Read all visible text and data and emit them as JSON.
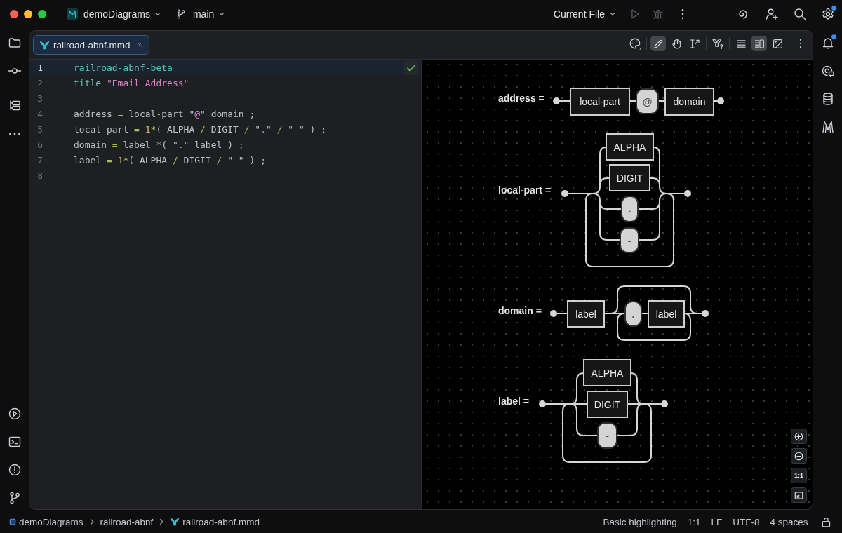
{
  "title_bar": {
    "project": "demoDiagrams",
    "branch": "main",
    "run_config": "Current File",
    "actions": [
      {
        "kind": "run",
        "disabled": true
      },
      {
        "kind": "debug",
        "disabled": true
      }
    ],
    "settings_badge": true
  },
  "right_toolbar": {
    "notifications_badge": true
  },
  "editor_tabs": [
    {
      "label": "railroad-abnf.mmd",
      "selected": true
    }
  ],
  "preview_toolbar": {
    "tools": [
      {
        "kind": "draw",
        "selected": true
      },
      {
        "kind": "pan",
        "selected": false
      },
      {
        "kind": "text",
        "selected": false
      }
    ],
    "view_modes": [
      {
        "kind": "editor",
        "selected": false
      },
      {
        "kind": "split",
        "selected": true
      },
      {
        "kind": "preview",
        "selected": false
      }
    ]
  },
  "editor": {
    "lines": [
      {
        "number": "1",
        "current": true,
        "tokens": [
          {
            "kind": "keyword",
            "text": "railroad-abnf-beta"
          }
        ]
      },
      {
        "number": "2",
        "current": false,
        "tokens": [
          {
            "kind": "keyword",
            "text": "title "
          },
          {
            "kind": "string",
            "text": "\"Email Address\""
          }
        ]
      },
      {
        "number": "3",
        "current": false
      },
      {
        "number": "4",
        "current": false,
        "tokens": [
          {
            "kind": "plain",
            "text": "address "
          },
          {
            "kind": "operator",
            "text": "="
          },
          {
            "kind": "plain",
            "text": " local"
          },
          {
            "kind": "operator",
            "text": "-"
          },
          {
            "kind": "plain",
            "text": "part \""
          },
          {
            "kind": "string",
            "text": "@"
          },
          {
            "kind": "plain",
            "text": "\" domain ;"
          }
        ]
      },
      {
        "number": "5",
        "current": false,
        "tokens": [
          {
            "kind": "plain",
            "text": "local"
          },
          {
            "kind": "operator",
            "text": "-"
          },
          {
            "kind": "plain",
            "text": "part "
          },
          {
            "kind": "operator",
            "text": "= "
          },
          {
            "kind": "number",
            "text": "1"
          },
          {
            "kind": "operator",
            "text": "*"
          },
          {
            "kind": "plain",
            "text": "( ALPHA "
          },
          {
            "kind": "operator",
            "text": "/"
          },
          {
            "kind": "plain",
            "text": " DIGIT "
          },
          {
            "kind": "operator",
            "text": "/"
          },
          {
            "kind": "plain",
            "text": " \""
          },
          {
            "kind": "string",
            "text": "."
          },
          {
            "kind": "plain",
            "text": "\" "
          },
          {
            "kind": "operator",
            "text": "/"
          },
          {
            "kind": "plain",
            "text": " \""
          },
          {
            "kind": "string",
            "text": "-"
          },
          {
            "kind": "plain",
            "text": "\" ) ;"
          }
        ]
      },
      {
        "number": "6",
        "current": false,
        "tokens": [
          {
            "kind": "plain",
            "text": "domain "
          },
          {
            "kind": "operator",
            "text": "="
          },
          {
            "kind": "plain",
            "text": " label "
          },
          {
            "kind": "operator",
            "text": "*"
          },
          {
            "kind": "plain",
            "text": "( \""
          },
          {
            "kind": "string",
            "text": "."
          },
          {
            "kind": "plain",
            "text": "\" label ) ;"
          }
        ]
      },
      {
        "number": "7",
        "current": false,
        "tokens": [
          {
            "kind": "plain",
            "text": "label "
          },
          {
            "kind": "operator",
            "text": "= "
          },
          {
            "kind": "number",
            "text": "1"
          },
          {
            "kind": "operator",
            "text": "*"
          },
          {
            "kind": "plain",
            "text": "( ALPHA "
          },
          {
            "kind": "operator",
            "text": "/"
          },
          {
            "kind": "plain",
            "text": " DIGIT "
          },
          {
            "kind": "operator",
            "text": "/"
          },
          {
            "kind": "plain",
            "text": " \""
          },
          {
            "kind": "string",
            "text": "-"
          },
          {
            "kind": "plain",
            "text": "\" ) ;"
          }
        ]
      },
      {
        "number": "8",
        "current": false
      }
    ]
  },
  "diagram": {
    "rules": [
      {
        "label": "address =",
        "nodes": [
          {
            "kind": "nonterminal",
            "text": "local-part"
          },
          {
            "kind": "terminal",
            "text": "@"
          },
          {
            "kind": "nonterminal",
            "text": "domain"
          }
        ]
      },
      {
        "label": "local-part =",
        "nodes": [
          {
            "kind": "nonterminal",
            "text": "ALPHA"
          },
          {
            "kind": "nonterminal",
            "text": "DIGIT"
          },
          {
            "kind": "terminal",
            "text": "."
          },
          {
            "kind": "terminal",
            "text": "-"
          }
        ]
      },
      {
        "label": "domain =",
        "nodes": [
          {
            "kind": "nonterminal",
            "text": "label"
          },
          {
            "kind": "terminal",
            "text": "."
          },
          {
            "kind": "nonterminal",
            "text": "label"
          }
        ]
      },
      {
        "label": "label =",
        "nodes": [
          {
            "kind": "nonterminal",
            "text": "ALPHA"
          },
          {
            "kind": "nonterminal",
            "text": "DIGIT"
          },
          {
            "kind": "terminal",
            "text": "-"
          }
        ]
      }
    ],
    "zoom_controls": [
      {
        "kind": "zoom-in"
      },
      {
        "kind": "zoom-out"
      },
      {
        "kind": "actual-size",
        "label": "1:1"
      },
      {
        "kind": "fit"
      }
    ]
  },
  "status_bar": {
    "breadcrumbs": [
      {
        "kind": "module",
        "label": "demoDiagrams"
      },
      {
        "kind": "folder",
        "label": "railroad-abnf"
      },
      {
        "kind": "file",
        "label": "railroad-abnf.mmd"
      }
    ],
    "items": [
      "Basic highlighting",
      "1:1",
      "LF",
      "UTF-8",
      "4 spaces"
    ],
    "read_only": false
  }
}
